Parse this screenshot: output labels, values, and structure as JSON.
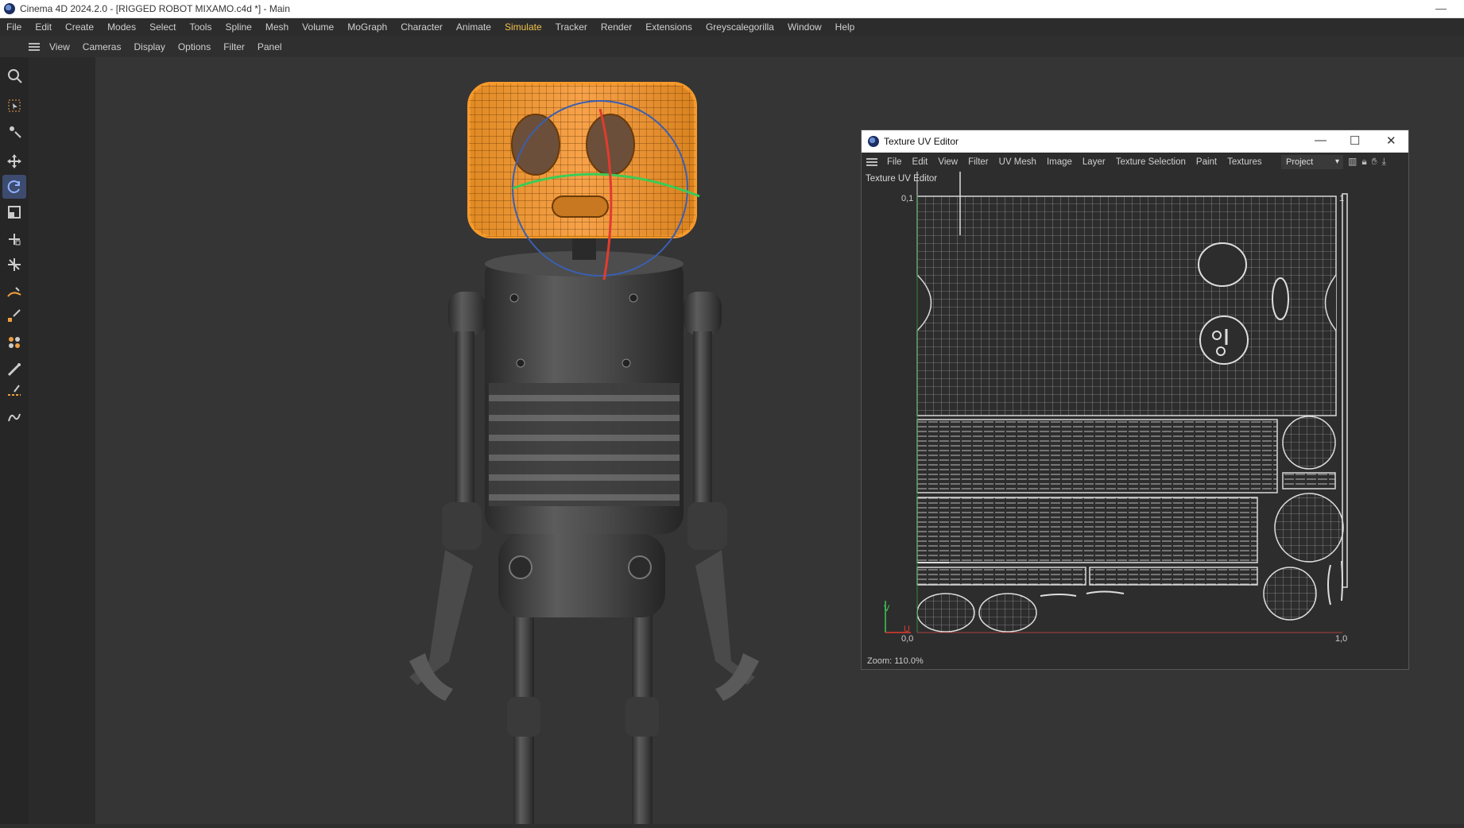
{
  "window": {
    "title": "Cinema 4D 2024.2.0 - [RIGGED ROBOT MIXAMO.c4d *] - Main",
    "minimize_glyph": "—"
  },
  "menubar": {
    "items": [
      "File",
      "Edit",
      "Create",
      "Modes",
      "Select",
      "Tools",
      "Spline",
      "Mesh",
      "Volume",
      "MoGraph",
      "Character",
      "Animate",
      "Simulate",
      "Tracker",
      "Render",
      "Extensions",
      "Greyscalegorilla",
      "Window",
      "Help"
    ],
    "active": "Simulate",
    "accent": "#f0c24a"
  },
  "viewport_menu": {
    "items": [
      "View",
      "Cameras",
      "Display",
      "Options",
      "Filter",
      "Panel"
    ]
  },
  "toolbar": {
    "tools": [
      "search-icon",
      "live-selection-icon",
      "model-tools-icon",
      "move-icon",
      "rotate-icon",
      "scale-icon",
      "transform-icon",
      "multi-snap-icon",
      "spline-pen-icon",
      "paint-pen-icon",
      "generators-icon",
      "brush-icon",
      "sketch-icon",
      "spline-smooth-icon"
    ],
    "selected": "rotate-icon",
    "selected_color": "#3d4b6e"
  },
  "selection_color": "#f79a2b",
  "uv_editor": {
    "title": "Texture UV Editor",
    "menu": [
      "File",
      "Edit",
      "View",
      "Filter",
      "UV Mesh",
      "Image",
      "Layer",
      "Texture Selection",
      "Paint",
      "Textures"
    ],
    "mode_select": "Project",
    "panel_label": "Texture UV Editor",
    "axis": {
      "top_left": "0,1",
      "top_right": "1",
      "origin": "0,0",
      "bottom_right": "1,0",
      "v": "V",
      "u": "U"
    },
    "zoom": "Zoom: 110.0%",
    "controls": {
      "minimize": "—",
      "maximize": "☐",
      "close": "✕"
    }
  }
}
